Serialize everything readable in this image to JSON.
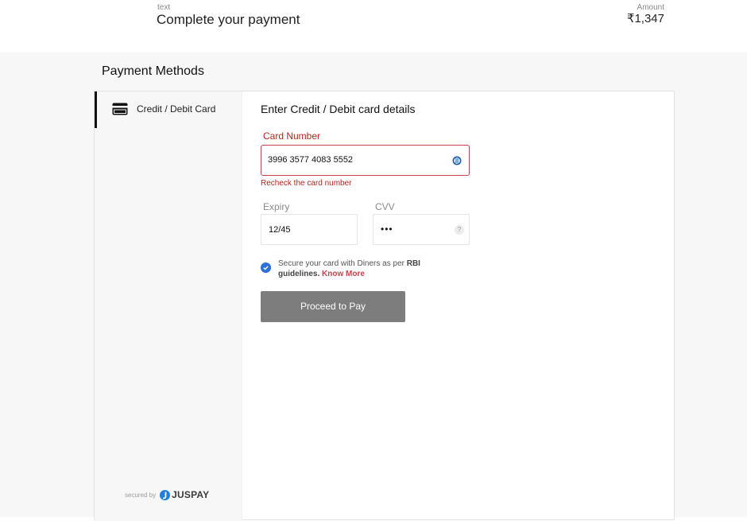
{
  "header": {
    "small_label": "text",
    "title": "Complete your payment",
    "amount_label": "Amount",
    "amount": "₹1,347"
  },
  "section_title": "Payment Methods",
  "sidebar": {
    "items": [
      {
        "label": "Credit / Debit Card",
        "icon": "card-icon",
        "selected": true
      }
    ],
    "secured_by": "secured by",
    "brand": "JUSPAY"
  },
  "form": {
    "title": "Enter Credit / Debit card details",
    "card_number_label": "Card Number",
    "card_number_value": "3996 3577 4083 5552",
    "card_network_icon": "diners-icon",
    "error": "Recheck the card number",
    "expiry_label": "Expiry",
    "expiry_value": "12/45",
    "cvv_label": "CVV",
    "cvv_value": "•••",
    "cvv_help": "?",
    "consent_prefix": "Secure your card with Diners as per ",
    "consent_bold": "RBI guidelines.",
    "consent_link": "Know More",
    "submit": "Proceed to Pay"
  },
  "colors": {
    "error": "#b3261e",
    "accent": "#2f6fd8",
    "button": "#7d7d7d"
  }
}
